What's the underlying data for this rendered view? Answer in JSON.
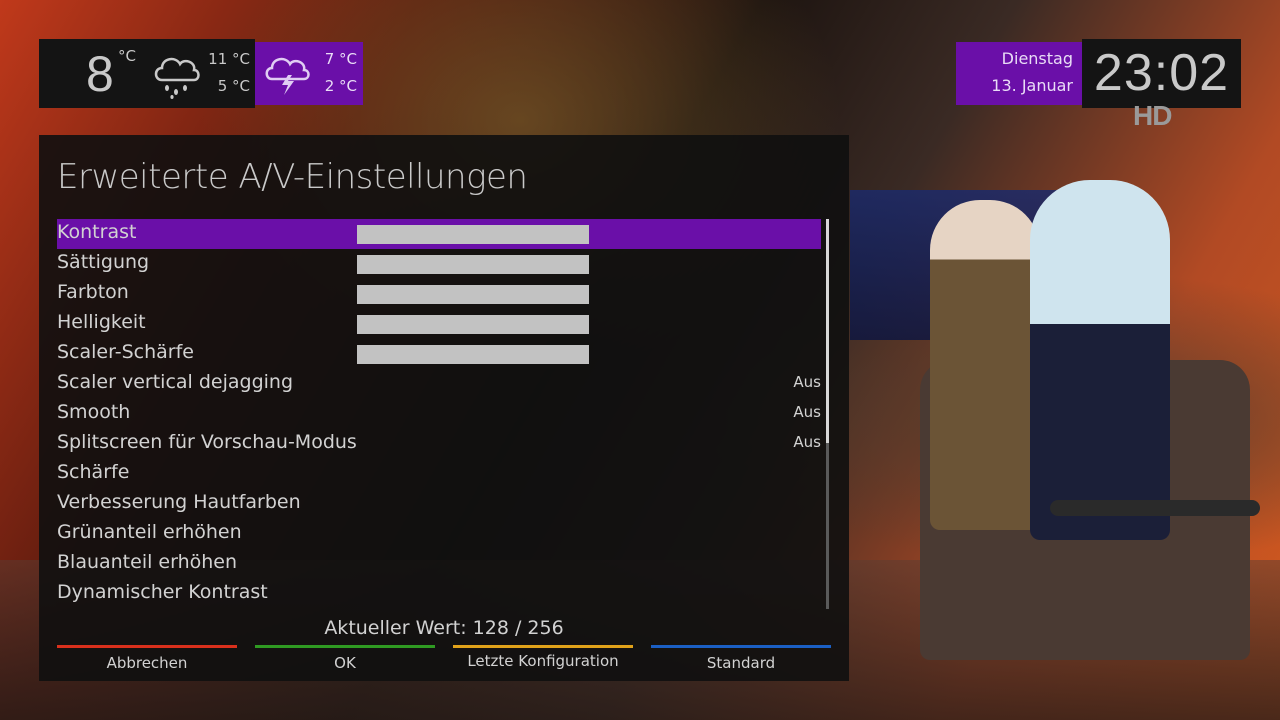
{
  "weather": {
    "today": {
      "temp": "8",
      "unit": "°C",
      "icon": "rain-cloud-icon",
      "high": "11 °C",
      "low": "5 °C"
    },
    "tomorrow": {
      "icon": "thunder-cloud-icon",
      "high": "7 °C",
      "low": "2 °C"
    }
  },
  "date": {
    "day": "Dienstag",
    "date": "13. Januar"
  },
  "clock": "23:02",
  "channel_badge": "HD",
  "menu": {
    "title": "Erweiterte A/V-Einstellungen",
    "items": [
      {
        "label": "Kontrast",
        "type": "slider",
        "selected": true
      },
      {
        "label": "Sättigung",
        "type": "slider"
      },
      {
        "label": "Farbton",
        "type": "slider"
      },
      {
        "label": "Helligkeit",
        "type": "slider"
      },
      {
        "label": "Scaler-Schärfe",
        "type": "slider"
      },
      {
        "label": "Scaler vertical dejagging",
        "value": "Aus"
      },
      {
        "label": "Smooth",
        "value": "Aus"
      },
      {
        "label": "Splitscreen für Vorschau-Modus",
        "value": "Aus"
      },
      {
        "label": "Schärfe"
      },
      {
        "label": "Verbesserung Hautfarben"
      },
      {
        "label": "Grünanteil erhöhen"
      },
      {
        "label": "Blauanteil erhöhen"
      },
      {
        "label": "Dynamischer Kontrast"
      }
    ],
    "current_value": "Aktueller Wert: 128 / 256"
  },
  "buttons": {
    "red": {
      "label": "Abbrechen",
      "color": "#d9301c"
    },
    "green": {
      "label": "OK",
      "color": "#2f9a22"
    },
    "yellow": {
      "label": "Letzte Konfiguration",
      "color": "#e0a21a"
    },
    "blue": {
      "label": "Standard",
      "color": "#1b5fc4"
    }
  },
  "colors": {
    "accent": "#6a0fa8",
    "panel": "#101010"
  }
}
